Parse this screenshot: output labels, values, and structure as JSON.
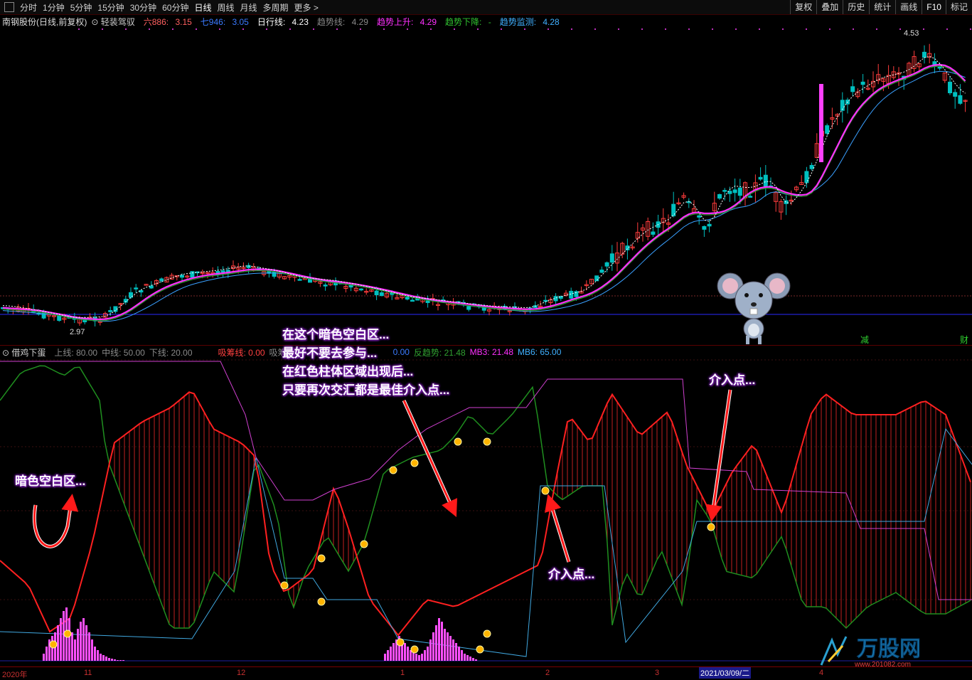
{
  "toolbar": {
    "items": [
      "分时",
      "1分钟",
      "5分钟",
      "15分钟",
      "30分钟",
      "60分钟",
      "日线",
      "周线",
      "月线",
      "多周期",
      "更多 >"
    ],
    "active": "日线",
    "right_buttons": [
      "复权",
      "叠加",
      "历史",
      "统计",
      "画线",
      "F10",
      "标记"
    ]
  },
  "main_legend": {
    "stock": "南钢股份(日线,前复权)",
    "indicator": "轻装驾驭",
    "v1_label": "六886:",
    "v1": "3.15",
    "v2_label": "七946:",
    "v2": "3.05",
    "v3_label": "日行线:",
    "v3": "4.23",
    "v4_label": "趋势线:",
    "v4": "4.29",
    "v5_label": "趋势上升:",
    "v5": "4.29",
    "v6_label": "趋势下降:",
    "v6": "-",
    "v7_label": "趋势监测:",
    "v7": "4.28"
  },
  "main_chart": {
    "high_label": "4.53",
    "low_label": "2.97",
    "badge_reduce": "减",
    "badge_finance": "财"
  },
  "sub_legend": {
    "name": "借鸡下蛋",
    "upper": "上线: 80.00",
    "mid": "中线: 50.00",
    "lower": "下线: 20.00",
    "absorb": "吸筹线: 0.00",
    "absorb2": "吸筹",
    "hidden_value": "0.00",
    "reverse": "反趋势: 21.48",
    "mb3": "MB3: 21.48",
    "mb6": "MB6: 65.00"
  },
  "annotations": {
    "dark_area": "暗色空白区...",
    "para1": "在这个暗色空白区...",
    "para2": "最好不要去参与...",
    "para3": "在红色柱体区域出现后...",
    "para4": "只要再次交汇都是最佳介入点...",
    "entry1": "介入点...",
    "entry2": "介入点..."
  },
  "xaxis": {
    "labels": [
      "2020年",
      "11",
      "12",
      "1",
      "2",
      "3",
      "4"
    ],
    "cursor_date": "2021/03/09/二"
  },
  "watermark": {
    "brand": "万股网",
    "url": "www.201082.com"
  },
  "colors": {
    "up": "#ff3c3c",
    "down": "#00c0c0",
    "ma_magenta": "#ff30ff",
    "ma_blue": "#3aa0ff",
    "ma_green": "#2a9a2a",
    "ma_white": "#ffffff",
    "red_line": "#ff2020",
    "green_line": "#1f8f1f",
    "cyan_line": "#40a8e0",
    "magenta_line": "#d040d0",
    "bg": "#000000"
  }
}
